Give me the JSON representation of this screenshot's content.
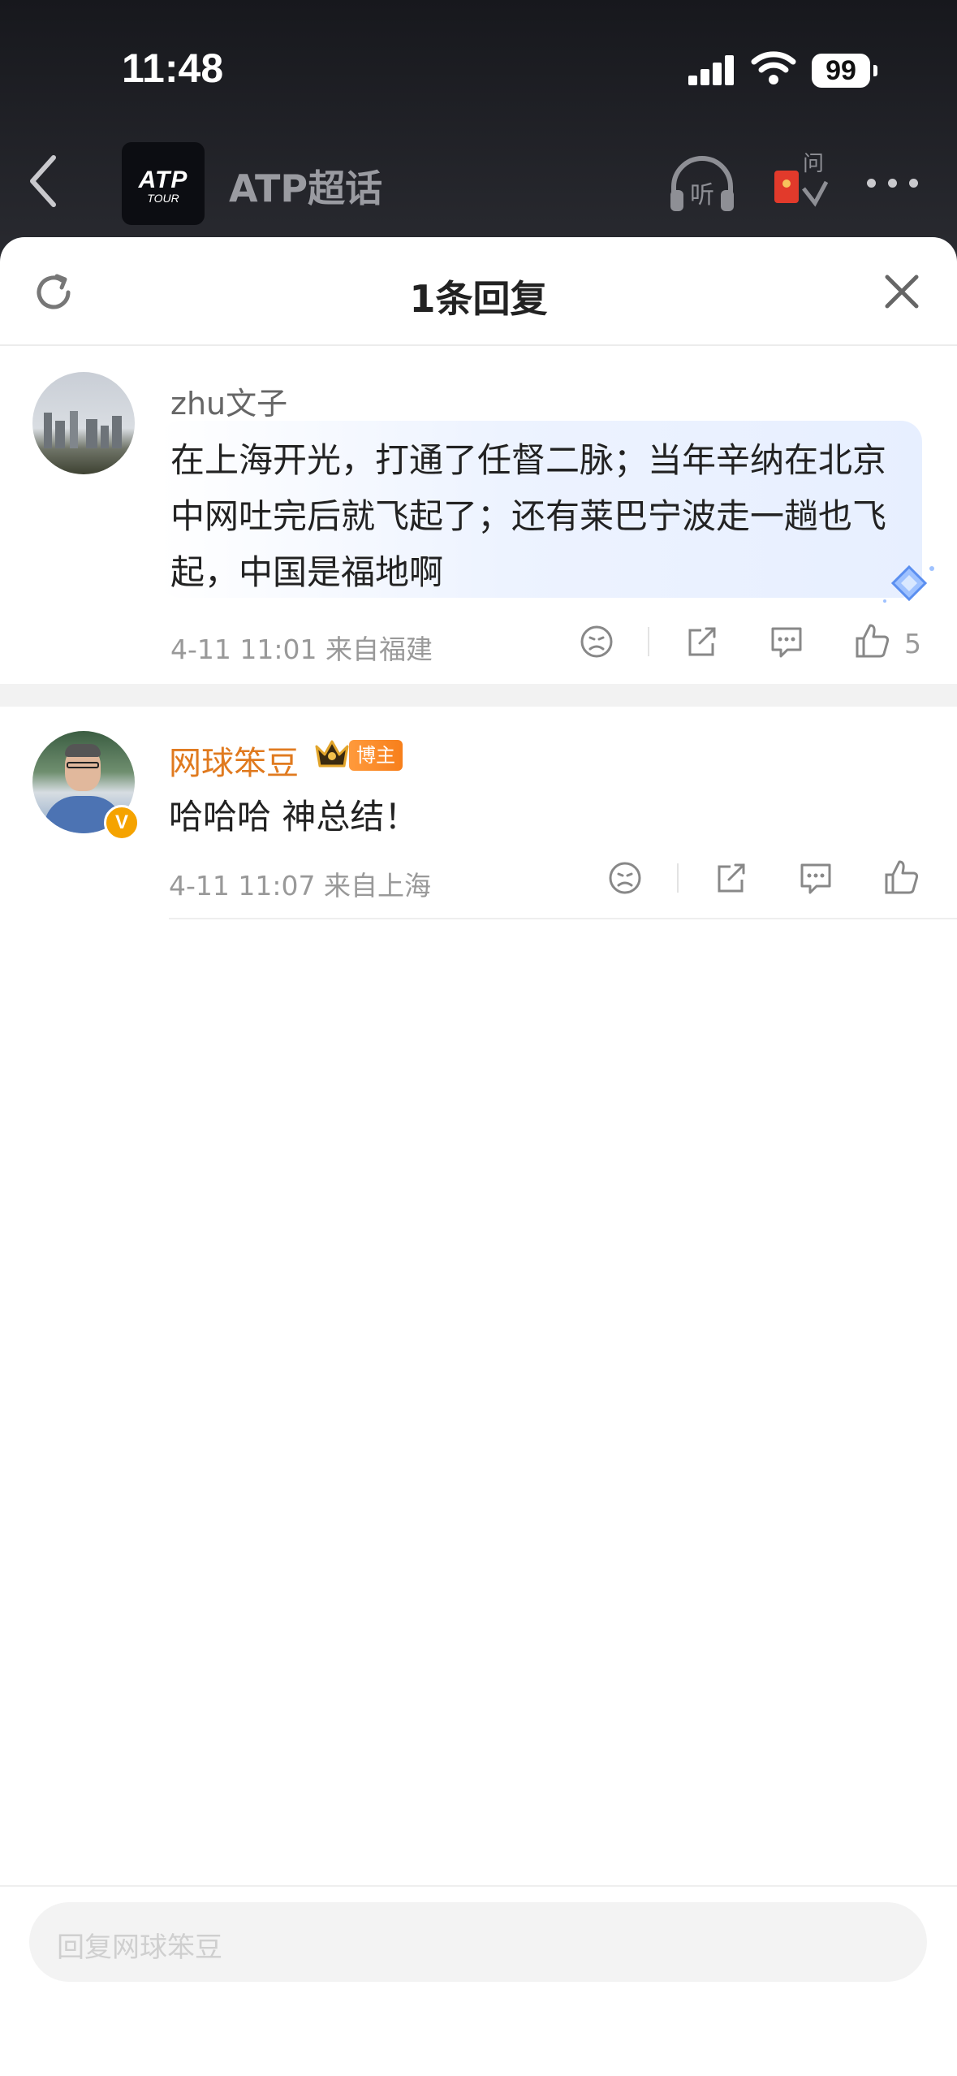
{
  "status_bar": {
    "time": "11:48",
    "battery": "99"
  },
  "nav": {
    "logo_line1": "ATP",
    "logo_line2": "TOUR",
    "title": "ATP超话"
  },
  "icons": {
    "listen_label": "听",
    "ask_label": "问"
  },
  "sheet": {
    "title": "1条回复"
  },
  "comment": {
    "user": "zhu文子",
    "text": "在上海开光，打通了任督二脉；当年辛纳在北京中网吐完后就飞起了；还有莱巴宁波走一趟也飞起，中国是福地啊",
    "time": "4-11 11:01",
    "location": "来自福建",
    "likes": "5"
  },
  "reply": {
    "user": "网球笨豆",
    "badge": "博主",
    "verified_mark": "V",
    "text": "哈哈哈 神总结！",
    "time": "4-11 11:07",
    "location": "来自上海"
  },
  "input": {
    "placeholder": "回复网球笨豆"
  },
  "colors": {
    "accent_orange": "#e07a1f",
    "badge_orange": "#f77f1b",
    "verified": "#f5a300"
  }
}
